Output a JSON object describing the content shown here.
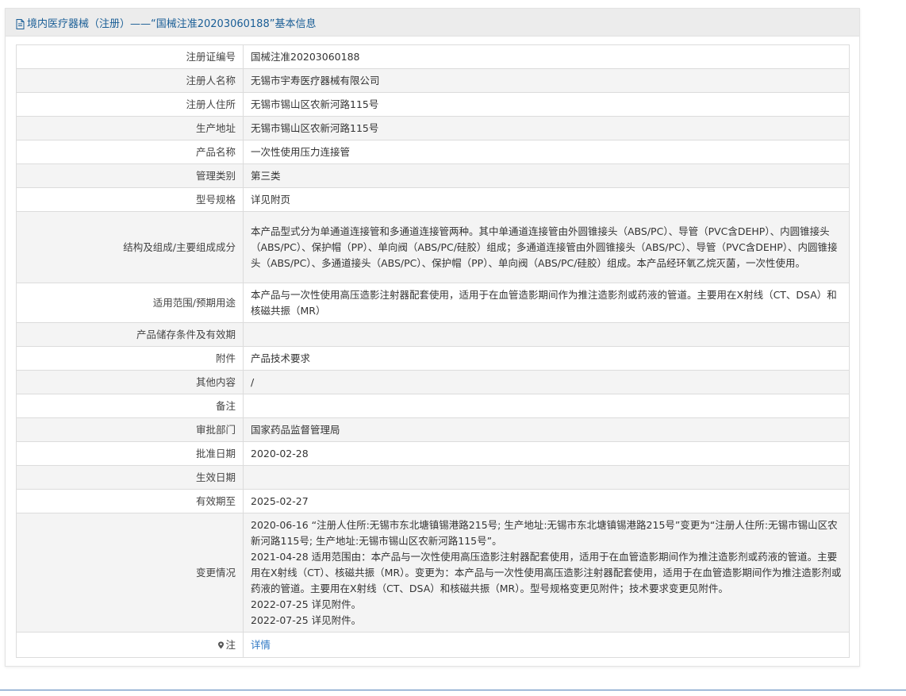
{
  "header": {
    "title": "境内医疗器械（注册）——“国械注准20203060188”基本信息",
    "icon": "document-icon"
  },
  "rows": [
    {
      "label": "注册证编号",
      "value": "国械注准20203060188"
    },
    {
      "label": "注册人名称",
      "value": "无锡市宇寿医疗器械有限公司"
    },
    {
      "label": "注册人住所",
      "value": "无锡市锡山区农新河路115号"
    },
    {
      "label": "生产地址",
      "value": "无锡市锡山区农新河路115号"
    },
    {
      "label": "产品名称",
      "value": "一次性使用压力连接管"
    },
    {
      "label": "管理类别",
      "value": "第三类"
    },
    {
      "label": "型号规格",
      "value": "详见附页"
    },
    {
      "label": "结构及组成/主要组成成分",
      "value": "本产品型式分为单通道连接管和多通道连接管两种。其中单通道连接管由外圆锥接头（ABS/PC）、导管（PVC含DEHP）、内圆锥接头（ABS/PC）、保护帽（PP）、单向阀（ABS/PC/硅胶）组成；多通道连接管由外圆锥接头（ABS/PC）、导管（PVC含DEHP）、内圆锥接头（ABS/PC）、多通道接头（ABS/PC）、保护帽（PP）、单向阀（ABS/PC/硅胶）组成。本产品经环氧乙烷灭菌，一次性使用。"
    },
    {
      "label": "适用范围/预期用途",
      "value": "本产品与一次性使用高压造影注射器配套使用，适用于在血管造影期间作为推注造影剂或药液的管道。主要用在X射线（CT、DSA）和核磁共振（MR）"
    },
    {
      "label": "产品储存条件及有效期",
      "value": ""
    },
    {
      "label": "附件",
      "value": "产品技术要求"
    },
    {
      "label": "其他内容",
      "value": "/"
    },
    {
      "label": "备注",
      "value": ""
    },
    {
      "label": "审批部门",
      "value": "国家药品监督管理局"
    },
    {
      "label": "批准日期",
      "value": "2020-02-28"
    },
    {
      "label": "生效日期",
      "value": ""
    },
    {
      "label": "有效期至",
      "value": "2025-02-27"
    }
  ],
  "changes": {
    "label": "变更情况",
    "lines": [
      "2020-06-16 “注册人住所:无锡市东北塘镇锡港路215号; 生产地址:无锡市东北塘镇锡港路215号”变更为“注册人住所:无锡市锡山区农新河路115号; 生产地址:无锡市锡山区农新河路115号”。",
      "2021-04-28 适用范围由：本产品与一次性使用高压造影注射器配套使用，适用于在血管造影期间作为推注造影剂或药液的管道。主要用在X射线（CT）、核磁共振（MR）。变更为：本产品与一次性使用高压造影注射器配套使用，适用于在血管造影期间作为推注造影剂或药液的管道。主要用在X射线（CT、DSA）和核磁共振（MR）。型号规格变更见附件；技术要求变更见附件。",
      "2022-07-25 详见附件。",
      "2022-07-25 详见附件。"
    ]
  },
  "note": {
    "label": "注",
    "icon": "map-pin-icon",
    "link_text": "详情"
  },
  "colors": {
    "title": "#1a5e96",
    "link": "#2f78c4",
    "header_bg": "#ececec",
    "stripe": "#f4f4f4",
    "border": "#dcdcdc"
  }
}
